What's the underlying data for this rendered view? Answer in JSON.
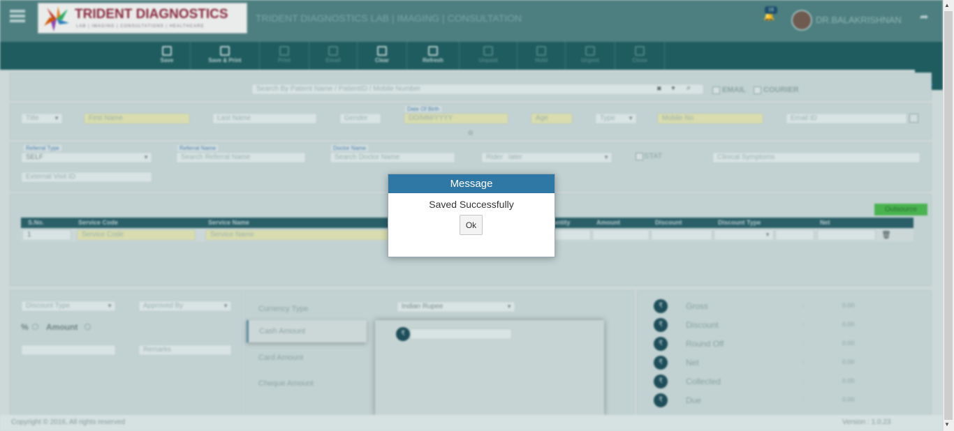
{
  "header": {
    "brand": "TRIDENT DIAGNOSTICS",
    "brand_tagline": "LAB | IMAGING | CONSULTATIONS | HEALTHCARE",
    "app_title": "TRIDENT DIAGNOSTICS LAB | IMAGING | CONSULTATION",
    "notification_count": "18",
    "user_name": "DR.BALAKRISHNAN"
  },
  "toolbar": [
    {
      "label": "Save",
      "enabled": true
    },
    {
      "label": "Save & Print",
      "enabled": true
    },
    {
      "label": "Print",
      "enabled": false
    },
    {
      "label": "Email",
      "enabled": false
    },
    {
      "label": "Clear",
      "enabled": true
    },
    {
      "label": "Refresh",
      "enabled": true
    },
    {
      "label": "Unpaid",
      "enabled": false
    },
    {
      "label": "Hold",
      "enabled": false
    },
    {
      "label": "Urgent",
      "enabled": false
    },
    {
      "label": "Close",
      "enabled": false
    }
  ],
  "search": {
    "placeholder": "Search By Patient Name / PatientID / Mobile Number",
    "email_label": "EMAIL",
    "courier_label": "COURIER"
  },
  "patient": {
    "title": "Title",
    "first_name": "First Name",
    "last_name": "Last Name",
    "gender": "Gender",
    "dob_label": "Date Of Birth",
    "dob_value": "DD/MM/YYYY",
    "age": "Age",
    "type": "Type",
    "mobile": "Mobile No",
    "email": "Email ID"
  },
  "referral": {
    "referral_type_label": "Referral Type",
    "referral_type_value": "SELF",
    "referral_name_label": "Referral Name",
    "referral_name_placeholder": "Search Referral Name",
    "doctor_name_label": "Doctor Name",
    "doctor_name_placeholder": "Search Doctor Name",
    "rider_label": "Rider",
    "rider_value": "later",
    "stat_label": "STAT",
    "clinical_symptoms": "Clinical Symptoms",
    "external_visit_id": "External Visit ID"
  },
  "services": {
    "outsource_label": "Outsource",
    "columns": [
      "S.No.",
      "Service Code",
      "Service Name",
      "Quantity",
      "Amount",
      "Discount",
      "Discount Type",
      "Net"
    ],
    "row": {
      "sno": "1",
      "service_code": "Service Code",
      "service_name": "Service Name"
    }
  },
  "billing": {
    "discount_type": "Discount Type",
    "approved_by": "Approved By",
    "percent_label": "%",
    "amount_label": "Amount",
    "remarks": "Remarks",
    "currency_type_label": "Currency Type",
    "currency_value": "Indian Rupee",
    "payment_tabs": [
      "Cash Amount",
      "Card Amount",
      "Cheque Amount"
    ],
    "currency_symbol": "₹"
  },
  "totals": [
    {
      "label": "Gross",
      "colon": ":",
      "value": "0.00"
    },
    {
      "label": "Discount",
      "colon": ":",
      "value": "0.00"
    },
    {
      "label": "Round Off",
      "colon": ":",
      "value": "0.00"
    },
    {
      "label": "Net",
      "colon": ":",
      "value": "0.00"
    },
    {
      "label": "Collected",
      "colon": ":",
      "value": "0.00"
    },
    {
      "label": "Due",
      "colon": ":",
      "value": "0.00"
    }
  ],
  "footer": {
    "copyright": "Copyright © 2016, All rights reserved",
    "version": "Version : 1.0.23"
  },
  "modal": {
    "title": "Message",
    "message": "Saved Successfully",
    "ok_label": "Ok"
  }
}
